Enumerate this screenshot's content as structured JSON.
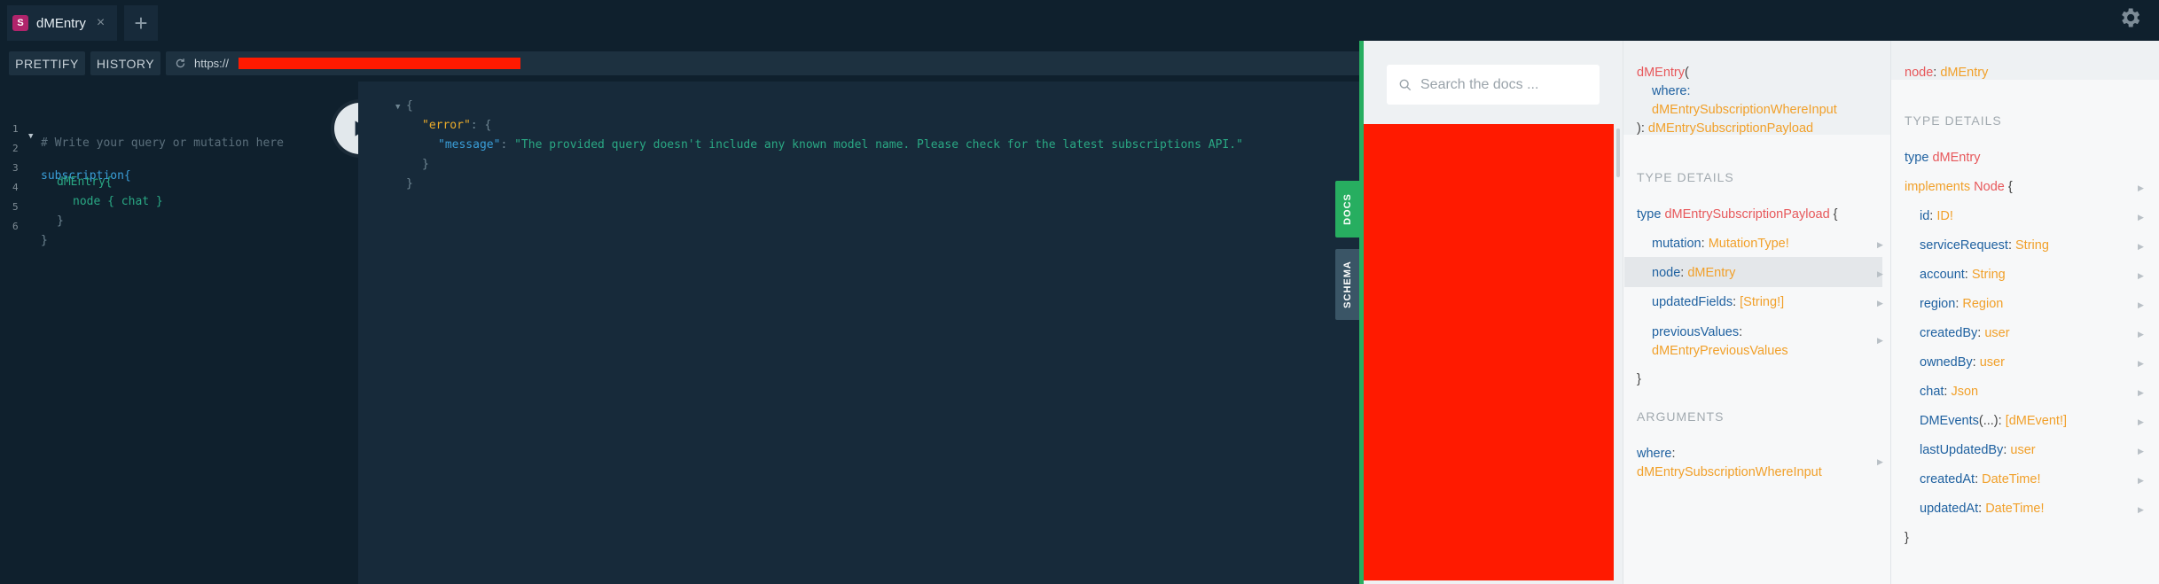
{
  "tabs": [
    {
      "badge": "S",
      "title": "dMEntry",
      "close": "×"
    }
  ],
  "add_tab": "+",
  "toolbar": {
    "prettify": "PRETTIFY",
    "history": "HISTORY",
    "url": "https://"
  },
  "editor": {
    "lines": [
      {
        "num": "1",
        "text": "# Write your query or mutation here"
      },
      {
        "num": "2",
        "text": "subscription{"
      },
      {
        "num": "3",
        "text": "dMEntry{"
      },
      {
        "num": "4",
        "text": "node { chat }"
      },
      {
        "num": "5",
        "text": "}"
      },
      {
        "num": "6",
        "text": "}"
      }
    ]
  },
  "result": {
    "open_brace": "{",
    "error_key": "\"error\"",
    "colon_brace": ": {",
    "message_key": "\"message\"",
    "colon": ": ",
    "message_value": "\"The provided query doesn't include any known model name. Please check for the latest subscriptions API.\"",
    "close_inner": "}",
    "close_outer": "}"
  },
  "side_tabs": {
    "docs": "DOCS",
    "schema": "SCHEMA"
  },
  "docs": {
    "search_placeholder": "Search the docs ...",
    "col2": {
      "sig_name": "dMEntry",
      "sig_open": "(",
      "where_label": "where:",
      "where_type": "dMEntrySubscriptionWhereInput",
      "sig_close": "):",
      "return_type": "dMEntrySubscriptionPayload",
      "type_details_heading": "TYPE DETAILS",
      "type_kw": "type",
      "type_name": "dMEntrySubscriptionPayload",
      "brace_open": "{",
      "fields": [
        {
          "name": "mutation",
          "type": "MutationType!"
        },
        {
          "name": "node",
          "type": "dMEntry"
        },
        {
          "name": "updatedFields",
          "type": "[String!]"
        },
        {
          "name": "previousValues",
          "type": "dMEntryPreviousValues"
        }
      ],
      "brace_close": "}",
      "arguments_heading": "ARGUMENTS",
      "arg_name": "where",
      "arg_type": "dMEntrySubscriptionWhereInput"
    },
    "col3": {
      "node_label": "node",
      "node_type": "dMEntry",
      "type_details_heading": "TYPE DETAILS",
      "type_kw": "type",
      "type_name": "dMEntry",
      "implements_kw": "implements",
      "implements_name": "Node",
      "brace_open": "{",
      "fields": [
        {
          "name": "id",
          "type": "ID!"
        },
        {
          "name": "serviceRequest",
          "type": "String"
        },
        {
          "name": "account",
          "type": "String"
        },
        {
          "name": "region",
          "type": "Region"
        },
        {
          "name": "createdBy",
          "type": "user"
        },
        {
          "name": "ownedBy",
          "type": "user"
        },
        {
          "name": "chat",
          "type": "Json"
        },
        {
          "name": "DMEvents",
          "args": "(...)",
          "type": "[dMEvent!]"
        },
        {
          "name": "lastUpdatedBy",
          "type": "user"
        },
        {
          "name": "createdAt",
          "type": "DateTime!"
        },
        {
          "name": "updatedAt",
          "type": "DateTime!"
        }
      ],
      "brace_close": "}"
    }
  },
  "colors": {
    "accent_green": "#27ae60",
    "redaction": "#ff1a00",
    "schema_tab": "#3a5566"
  }
}
